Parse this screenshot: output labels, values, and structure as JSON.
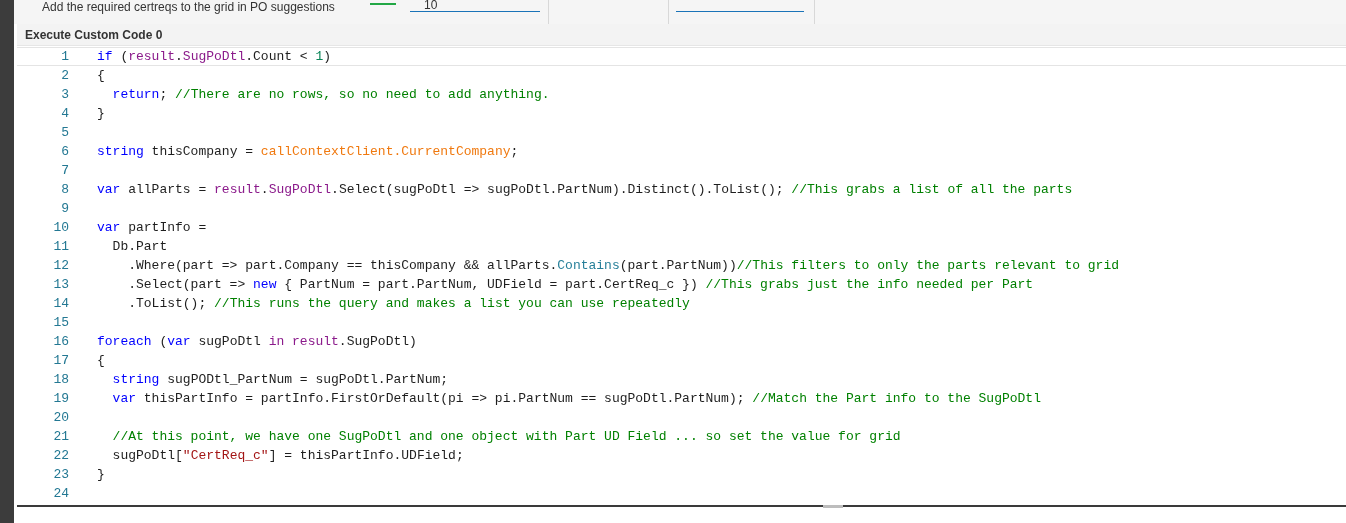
{
  "top_bar": {
    "label": "Add the required certreqs to the grid in PO suggestions",
    "field_value": "10"
  },
  "editor": {
    "title": "Execute Custom Code 0",
    "lines": [
      {
        "number": "1",
        "current": true,
        "tokens": [
          {
            "kind": "keyword",
            "text": "if"
          },
          {
            "kind": "plain",
            "text": " ("
          },
          {
            "kind": "member",
            "text": "result"
          },
          {
            "kind": "plain",
            "text": "."
          },
          {
            "kind": "member",
            "text": "SugPoDtl"
          },
          {
            "kind": "plain",
            "text": ".Count < "
          },
          {
            "kind": "number",
            "text": "1"
          },
          {
            "kind": "plain",
            "text": ")"
          }
        ]
      },
      {
        "number": "2",
        "current": false,
        "tokens": [
          {
            "kind": "plain",
            "text": "{"
          }
        ]
      },
      {
        "number": "3",
        "current": false,
        "tokens": [
          {
            "kind": "keyword",
            "text": "  return"
          },
          {
            "kind": "plain",
            "text": "; "
          },
          {
            "kind": "comment",
            "text": "//There are no rows, so no need to add anything."
          }
        ]
      },
      {
        "number": "4",
        "current": false,
        "tokens": [
          {
            "kind": "plain",
            "text": "}"
          }
        ]
      },
      {
        "number": "5",
        "current": false
      },
      {
        "number": "6",
        "current": false,
        "tokens": [
          {
            "kind": "keyword",
            "text": "string"
          },
          {
            "kind": "plain",
            "text": " thisCompany = "
          },
          {
            "kind": "context",
            "text": "callContextClient.CurrentCompany"
          },
          {
            "kind": "plain",
            "text": ";"
          }
        ]
      },
      {
        "number": "7",
        "current": false
      },
      {
        "number": "8",
        "current": false,
        "tokens": [
          {
            "kind": "keyword",
            "text": "var"
          },
          {
            "kind": "plain",
            "text": " allParts = "
          },
          {
            "kind": "member",
            "text": "result"
          },
          {
            "kind": "plain",
            "text": "."
          },
          {
            "kind": "member",
            "text": "SugPoDtl"
          },
          {
            "kind": "plain",
            "text": ".Select(sugPoDtl => sugPoDtl.PartNum).Distinct().ToList(); "
          },
          {
            "kind": "comment",
            "text": "//This grabs a list of all the parts"
          }
        ]
      },
      {
        "number": "9",
        "current": false
      },
      {
        "number": "10",
        "current": false,
        "tokens": [
          {
            "kind": "keyword",
            "text": "var"
          },
          {
            "kind": "plain",
            "text": " partInfo ="
          }
        ]
      },
      {
        "number": "11",
        "current": false,
        "tokens": [
          {
            "kind": "plain",
            "text": "  Db.Part"
          }
        ]
      },
      {
        "number": "12",
        "current": false,
        "tokens": [
          {
            "kind": "plain",
            "text": "    .Where(part => part.Company == thisCompany && allParts."
          },
          {
            "kind": "method",
            "text": "Contains"
          },
          {
            "kind": "plain",
            "text": "(part.PartNum))"
          },
          {
            "kind": "comment",
            "text": "//This filters to only the parts relevant to grid"
          }
        ]
      },
      {
        "number": "13",
        "current": false,
        "tokens": [
          {
            "kind": "plain",
            "text": "    .Select(part => "
          },
          {
            "kind": "keyword",
            "text": "new"
          },
          {
            "kind": "plain",
            "text": " { PartNum = part.PartNum, UDField = part.CertReq_c }) "
          },
          {
            "kind": "comment",
            "text": "//This grabs just the info needed per Part"
          }
        ]
      },
      {
        "number": "14",
        "current": false,
        "tokens": [
          {
            "kind": "plain",
            "text": "    .ToList(); "
          },
          {
            "kind": "comment",
            "text": "//This runs the query and makes a list you can use repeatedly"
          }
        ]
      },
      {
        "number": "15",
        "current": false
      },
      {
        "number": "16",
        "current": false,
        "tokens": [
          {
            "kind": "keyword",
            "text": "foreach"
          },
          {
            "kind": "plain",
            "text": " ("
          },
          {
            "kind": "keyword",
            "text": "var"
          },
          {
            "kind": "plain",
            "text": " sugPoDtl "
          },
          {
            "kind": "member",
            "text": "in"
          },
          {
            "kind": "member",
            "text": " result"
          },
          {
            "kind": "plain",
            "text": ".SugPoDtl)"
          }
        ]
      },
      {
        "number": "17",
        "current": false,
        "tokens": [
          {
            "kind": "plain",
            "text": "{"
          }
        ]
      },
      {
        "number": "18",
        "current": false,
        "tokens": [
          {
            "kind": "keyword",
            "text": "  string"
          },
          {
            "kind": "plain",
            "text": " sugPODtl_PartNum = sugPoDtl.PartNum;"
          }
        ]
      },
      {
        "number": "19",
        "current": false,
        "tokens": [
          {
            "kind": "keyword",
            "text": "  var"
          },
          {
            "kind": "plain",
            "text": " thisPartInfo = partInfo.FirstOrDefault(pi => pi.PartNum == sugPoDtl.PartNum); "
          },
          {
            "kind": "comment",
            "text": "//Match the Part info to the SugPoDtl"
          }
        ]
      },
      {
        "number": "20",
        "current": false
      },
      {
        "number": "21",
        "current": false,
        "tokens": [
          {
            "kind": "comment",
            "text": "  //At this point, we have one SugPoDtl and one object with Part UD Field ... so set the value for grid"
          }
        ]
      },
      {
        "number": "22",
        "current": false,
        "tokens": [
          {
            "kind": "plain",
            "text": "  sugPoDtl["
          },
          {
            "kind": "string",
            "text": "\"CertReq_c\""
          },
          {
            "kind": "plain",
            "text": "] = thisPartInfo.UDField;"
          }
        ]
      },
      {
        "number": "23",
        "current": false,
        "tokens": [
          {
            "kind": "plain",
            "text": "}"
          }
        ]
      },
      {
        "number": "24",
        "current": false
      }
    ]
  }
}
